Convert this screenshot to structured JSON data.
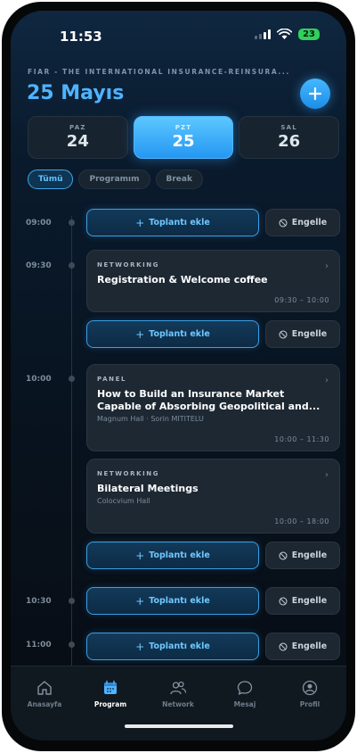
{
  "status": {
    "time": "11:53",
    "battery": "23"
  },
  "header": {
    "event_name": "FIAR - THE INTERNATIONAL INSURANCE-REINSURA...",
    "date_title": "25 Mayıs"
  },
  "days": [
    {
      "dn": "PAZ",
      "dd": "24",
      "active": false
    },
    {
      "dn": "PZT",
      "dd": "25",
      "active": true
    },
    {
      "dn": "SAL",
      "dd": "26",
      "active": false
    }
  ],
  "filters": [
    {
      "label": "Tümü",
      "active": true
    },
    {
      "label": "Programım",
      "active": false
    },
    {
      "label": "Break",
      "active": false
    }
  ],
  "times": [
    "09:00",
    "09:30",
    "10:00",
    "10:30",
    "11:00"
  ],
  "actions": {
    "add_label": "Toplantı ekle",
    "block_label": "Engelle"
  },
  "sessions": [
    {
      "category": "NETWORKING",
      "title": "Registration & Welcome coffee",
      "location": "",
      "time": "09:30 – 10:00"
    },
    {
      "category": "PANEL",
      "title": "How to Build an Insurance Market Capable of Absorbing Geopolitical and...",
      "location": "Magnum Hall · Sorin MITITELU",
      "time": "10:00 – 11:30"
    },
    {
      "category": "NETWORKING",
      "title": "Bilateral Meetings",
      "location": "Colocvium Hall",
      "time": "10:00 – 18:00"
    }
  ],
  "nav": [
    {
      "label": "Anasayfa",
      "icon": "home-icon",
      "active": false
    },
    {
      "label": "Program",
      "icon": "calendar-icon",
      "active": true
    },
    {
      "label": "Network",
      "icon": "people-icon",
      "active": false
    },
    {
      "label": "Mesaj",
      "icon": "chat-icon",
      "active": false
    },
    {
      "label": "Profil",
      "icon": "profile-icon",
      "active": false
    }
  ],
  "colors": {
    "accent": "#4fb3ff",
    "background": "#08131f"
  }
}
